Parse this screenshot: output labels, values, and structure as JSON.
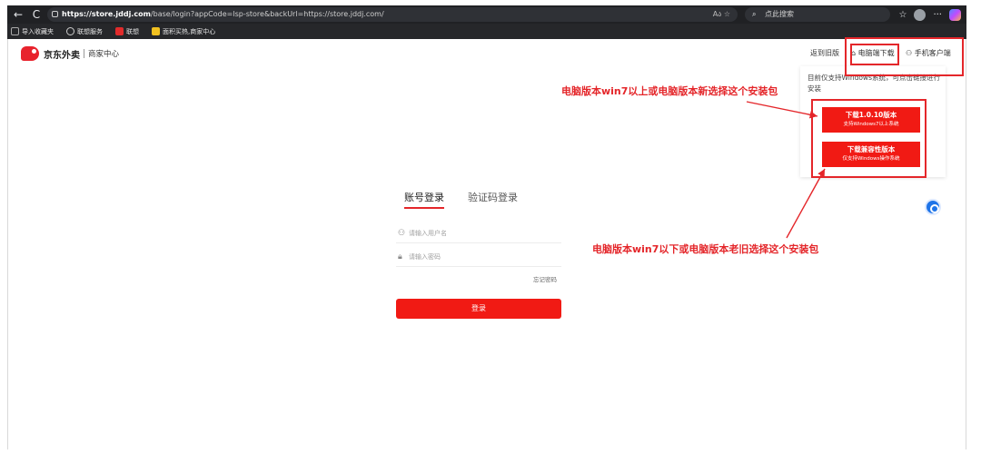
{
  "browser": {
    "back_glyph": "←",
    "refresh_glyph": "C",
    "url_host": "https://store.jddj.com",
    "url_path": "/base/login?appCode=lsp-store&backUrl=https://store.jddj.com/",
    "url_icons": "A⁠ა ☆",
    "search_placeholder": "点此搜索",
    "more_glyph": "···"
  },
  "bookmarks": [
    {
      "label": "导入收藏夹",
      "color": "#7a7a7a"
    },
    {
      "label": "联想服务",
      "color": "#9aa0a6"
    },
    {
      "label": "联想",
      "color": "#e12b2b"
    },
    {
      "label": "面积买热,商家中心",
      "color": "#f0c020"
    }
  ],
  "header": {
    "logo_text": "京东外卖",
    "logo_sub": "商家中心",
    "old_version": "返到旧版",
    "pc_download": "电脑端下载",
    "mobile_client": "手机客户端"
  },
  "download_panel": {
    "note": "目前仅支持Windows系统，可点击链接进行安装",
    "btn1_title": "下载1.0.10版本",
    "btn1_sub": "支持Windows7以上系统",
    "btn2_title": "下载兼容性版本",
    "btn2_sub": "仅支持Windows操作系统"
  },
  "annotations": {
    "top": "电脑版本win7以上或电脑版本新选择这个安装包",
    "bottom": "电脑版本win7以下或电脑版本老旧选择这个安装包"
  },
  "login": {
    "tab_account": "账号登录",
    "tab_code": "验证码登录",
    "username_placeholder": "请输入用户名",
    "password_placeholder": "请输入密码",
    "forgot": "忘记密码",
    "submit": "登录"
  },
  "colors": {
    "accent_red": "#f11a14",
    "annotation_red": "#e4262a",
    "help_blue": "#1e74e8"
  }
}
